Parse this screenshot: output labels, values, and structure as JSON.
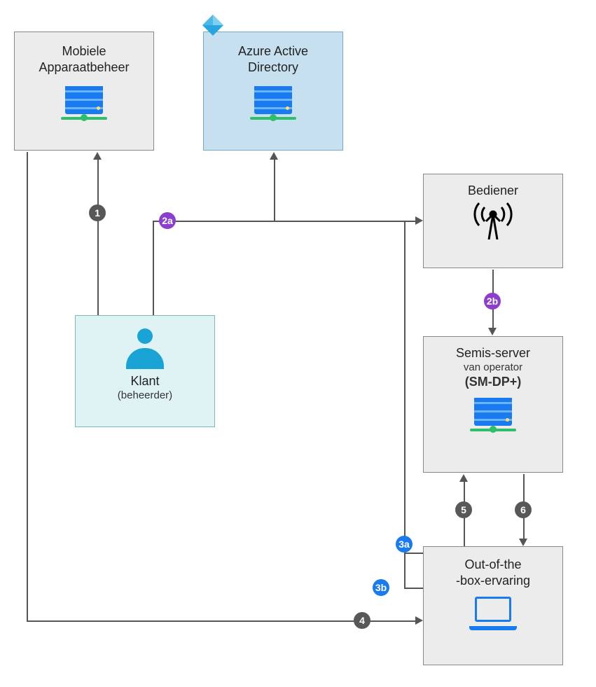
{
  "nodes": {
    "mdm": {
      "line1": "Mobiele",
      "line2": "Apparaatbeheer"
    },
    "aad": {
      "line1": "Azure Active",
      "line2": "Directory"
    },
    "customer": {
      "title": "Klant",
      "sub": "(beheerder)"
    },
    "operator": {
      "title": "Bediener"
    },
    "smdp": {
      "line1": "Semis-server",
      "line2": "van operator",
      "line3": "(SM-DP+)"
    },
    "oobe": {
      "line1": "Out-of-the",
      "line2": "-box-ervaring"
    }
  },
  "steps": {
    "s1": "1",
    "s2a": "2a",
    "s2b": "2b",
    "s3a": "3a",
    "s3b": "3b",
    "s4": "4",
    "s5": "5",
    "s6": "6"
  },
  "colors": {
    "gray": "#585858",
    "purple": "#8c3fcf",
    "blue": "#1a7af0"
  }
}
